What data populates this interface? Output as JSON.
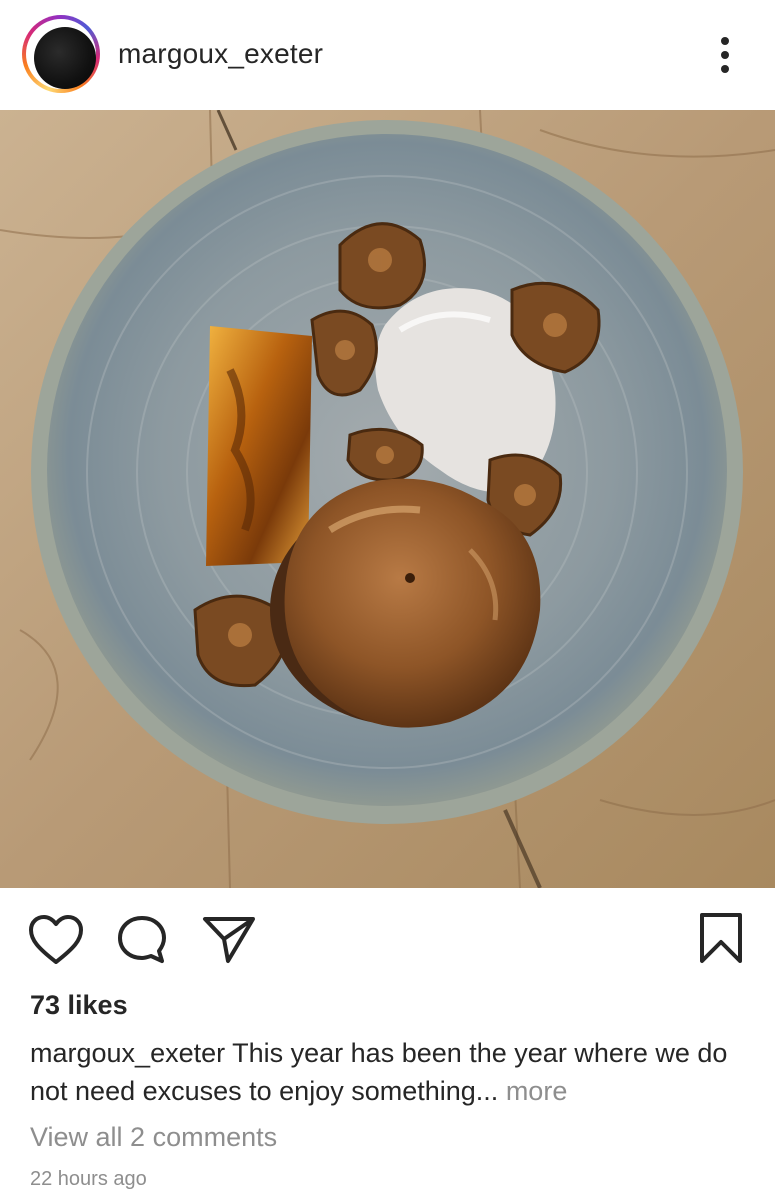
{
  "post": {
    "username": "margoux_exeter",
    "likes": "73 likes",
    "caption": {
      "username": "margoux_exeter",
      "text": " This year has been the year where we do not need excuses to enjoy something",
      "ellipsis": "...",
      "more": " more"
    },
    "view_comments": "View all 2 comments",
    "timestamp": "22 hours ago"
  },
  "icons": {
    "more": "vertical-ellipsis-icon",
    "like": "heart-icon",
    "comment": "speech-bubble-icon",
    "share": "paper-plane-icon",
    "save": "bookmark-icon"
  },
  "colors": {
    "text": "#262626",
    "muted": "#8e8e8e",
    "ring_gradient": [
      "#feda75",
      "#fa7e1e",
      "#d62976",
      "#962fbf",
      "#4f5bd5"
    ]
  }
}
